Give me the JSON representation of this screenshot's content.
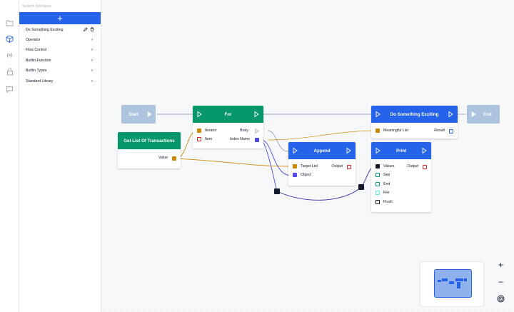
{
  "rail": {
    "icons": [
      "folder-icon",
      "cube-icon",
      "variable-icon",
      "lock-icon",
      "comment-icon"
    ],
    "variable_glyph": "(x)"
  },
  "sidebar": {
    "search_placeholder": "Search functions",
    "add_label": "+",
    "current_function": "Do Something Exciting",
    "categories": [
      {
        "label": "Operator"
      },
      {
        "label": "Flow Control"
      },
      {
        "label": "Builtin Function"
      },
      {
        "label": "Builtin Types"
      },
      {
        "label": "Standard Library"
      }
    ],
    "chevron": "›"
  },
  "colors": {
    "accent": "#2563eb",
    "green_node": "#059669",
    "event_pill": "#aec3dd",
    "pin_orange": "#ca8a04",
    "pin_purple": "#4f46e5",
    "pin_red": "#dc2626",
    "pin_teal": "#0d9488"
  },
  "nodes": {
    "start": {
      "title": "Start"
    },
    "end": {
      "title": "End"
    },
    "get_list": {
      "title": "Get List Of Transactions",
      "out": "Value"
    },
    "for": {
      "title": "For",
      "in1": "Iterator",
      "in2": "Item",
      "out1": "Body",
      "out2": "Index Name"
    },
    "append": {
      "title": "Append",
      "in1": "Target List",
      "in2": "Object",
      "out1": "Output"
    },
    "dse": {
      "title": "Do Something Exciting",
      "in1": "Meaningful List",
      "out1": "Result"
    },
    "print": {
      "title": "Print",
      "in1": "Values",
      "in2": "Sep",
      "in3": "End",
      "in4": "File",
      "in5": "Flush",
      "out1": "Output"
    }
  },
  "zoom": {
    "in": "+",
    "out": "−"
  }
}
